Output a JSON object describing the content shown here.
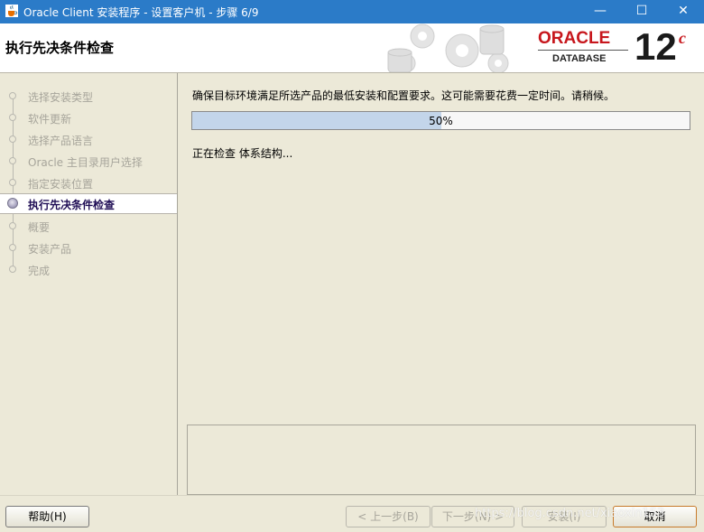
{
  "window": {
    "title": "Oracle Client 安装程序 - 设置客户机 - 步骤 6/9",
    "minimize_glyph": "—",
    "maximize_glyph": "☐",
    "close_glyph": "✕"
  },
  "header": {
    "step_title": "执行先决条件检查",
    "logo": {
      "brand": "ORACLE",
      "product": "DATABASE",
      "version": "12",
      "version_suffix": "c"
    }
  },
  "sidebar": {
    "steps": [
      {
        "label": "选择安装类型"
      },
      {
        "label": "软件更新"
      },
      {
        "label": "选择产品语言"
      },
      {
        "label": "Oracle 主目录用户选择"
      },
      {
        "label": "指定安装位置"
      },
      {
        "label": "执行先决条件检查",
        "active": true
      },
      {
        "label": "概要"
      },
      {
        "label": "安装产品"
      },
      {
        "label": "完成"
      }
    ]
  },
  "main": {
    "description": "确保目标环境满足所选产品的最低安装和配置要求。这可能需要花费一定时间。请稍候。",
    "progress_percent": 50,
    "progress_label": "50%",
    "status_text": "正在检查 体系结构..."
  },
  "footer": {
    "help_label": "帮助(H)",
    "back_label": "< 上一步(B)",
    "next_label": "下一步(N) >",
    "install_label": "安装(I)",
    "cancel_label": "取消"
  },
  "watermark": "https://blog.csdn.net/xiaoxin153",
  "colors": {
    "titlebar": "#2b7bc8",
    "oracle_red": "#c7161c",
    "progress_fill": "#c3d5ea",
    "active_step_text": "#1f0d55"
  },
  "icons": {
    "app": "java-cup-icon",
    "gears": "gears-and-database-decoration"
  }
}
